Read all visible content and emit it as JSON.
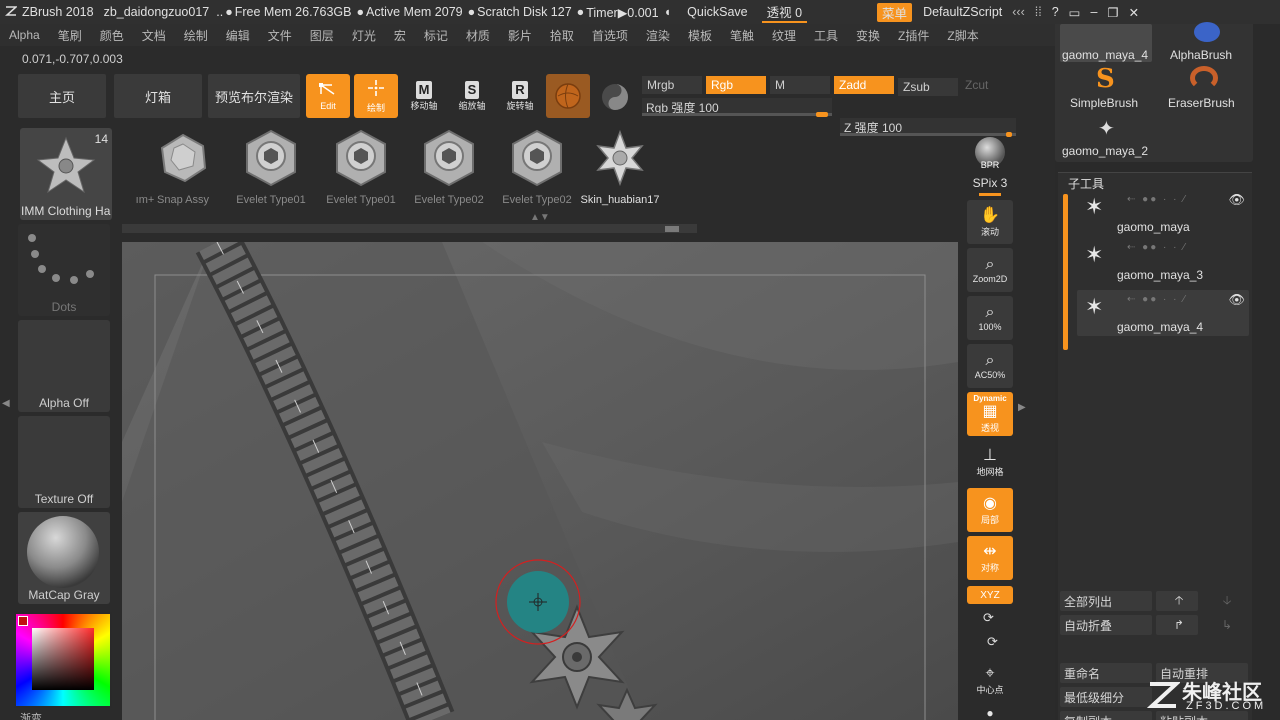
{
  "titlebar": {
    "app": "ZBrush 2018",
    "doc": "zb_daidongzuo017",
    "dots": "..",
    "free_mem": "Free Mem 26.763GB",
    "active_mem": "Active Mem 2079",
    "scratch": "Scratch Disk 127",
    "timer": "Timer▶0.001",
    "quicksave": "QuickSave",
    "perspective": "透视 0",
    "menu": "菜单",
    "script": "DefaultZScript"
  },
  "menubar": [
    "Alpha",
    "笔刷",
    "颜色",
    "文档",
    "绘制",
    "编辑",
    "文件",
    "图层",
    "灯光",
    "宏",
    "标记",
    "材质",
    "影片",
    "拾取",
    "首选项",
    "渲染",
    "模板",
    "笔触",
    "纹理",
    "工具",
    "变换",
    "Z插件",
    "Z脚本"
  ],
  "coords": "0.071,-0.707,0.003",
  "shelf": {
    "home": "主页",
    "lightbox": "灯箱",
    "bpr_preview": "预览布尔渲染",
    "edit": "Edit",
    "draw": "绘制",
    "move": "移动轴",
    "scale": "缩放轴",
    "rotate": "旋转轴",
    "move_letter": "M",
    "scale_letter": "S",
    "rotate_letter": "R"
  },
  "channels": {
    "mrgb": "Mrgb",
    "rgb": "Rgb",
    "m": "M",
    "zadd": "Zadd",
    "zsub": "Zsub",
    "zcut": "Zcut",
    "rgb_intensity": "Rgb 强度 100",
    "z_intensity": "Z 强度 100"
  },
  "left": {
    "tool_name": "IMM Clothing Ha",
    "tool_count": "14",
    "stroke": "Dots",
    "alpha": "Alpha Off",
    "texture": "Texture Off",
    "material": "MatCap Gray",
    "bottom_label": "渐变"
  },
  "brush_strip": [
    {
      "label": "ım+"
    },
    {
      "label": "Snap Assy"
    },
    {
      "label": "Evelet Type01"
    },
    {
      "label": "Evelet Type01"
    },
    {
      "label": "Evelet Type02"
    },
    {
      "label": "Evelet Type02"
    },
    {
      "label": "Skin_huabian17"
    }
  ],
  "right_tools": {
    "bpr": "BPR",
    "spix": "SPix 3",
    "scroll": "滚动",
    "zoom2d": "Zoom2D",
    "zoom100": "100%",
    "ac50": "AC50%",
    "dynamic": "Dynamic",
    "persp": "透视",
    "floor": "地网格",
    "local": "局部",
    "symmetry": "对称",
    "xyz": "XYZ",
    "center": "中心点"
  },
  "right_panel": {
    "top_items": [
      {
        "label": "gaomo_maya_4"
      },
      {
        "label": "AlphaBrush"
      },
      {
        "label": "SimpleBrush"
      },
      {
        "label": "EraserBrush"
      },
      {
        "label": "gaomo_maya_2"
      }
    ],
    "subtool_header": "子工具",
    "subtools": [
      {
        "name": "gaomo_maya"
      },
      {
        "name": "gaomo_maya_3"
      },
      {
        "name": "gaomo_maya_4"
      }
    ],
    "list_all": "全部列出",
    "auto_collapse": "自动折叠",
    "rename": "重命名",
    "auto_reorder": "自动重排",
    "lowest_subdiv": "最低级细分",
    "copy": "复制副本",
    "paste": "粘贴副本"
  },
  "watermark": {
    "name": "朱峰社区",
    "url": "ZF3D.COM"
  },
  "colors": {
    "accent": "#f7931e",
    "viewport": "#595959",
    "panel": "#2a2a2a",
    "brush_cursor": "#1f8a8a"
  }
}
